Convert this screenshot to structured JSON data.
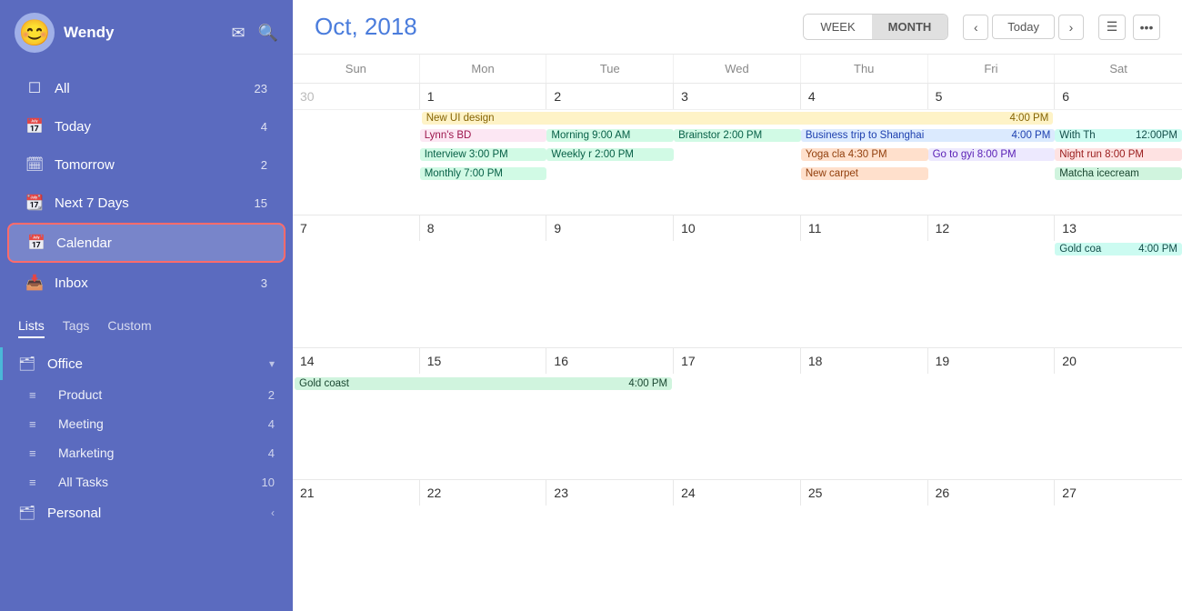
{
  "sidebar": {
    "user": {
      "name": "Wendy",
      "avatar_emoji": "😊"
    },
    "nav_items": [
      {
        "id": "all",
        "label": "All",
        "badge": "23",
        "icon": "☐"
      },
      {
        "id": "today",
        "label": "Today",
        "badge": "4",
        "icon": "📅"
      },
      {
        "id": "tomorrow",
        "label": "Tomorrow",
        "badge": "2",
        "icon": "🗓"
      },
      {
        "id": "next7",
        "label": "Next 7 Days",
        "badge": "15",
        "icon": "📆"
      },
      {
        "id": "calendar",
        "label": "Calendar",
        "badge": "",
        "icon": "📅",
        "active": true
      },
      {
        "id": "inbox",
        "label": "Inbox",
        "badge": "3",
        "icon": "📥"
      }
    ],
    "tabs": [
      {
        "id": "lists",
        "label": "Lists",
        "active": true
      },
      {
        "id": "tags",
        "label": "Tags"
      },
      {
        "id": "custom",
        "label": "Custom"
      }
    ],
    "sections": [
      {
        "id": "office",
        "label": "Office",
        "icon": "🗂",
        "has_bar": true
      },
      {
        "id": "product",
        "label": "Product",
        "icon": "≡",
        "badge": "2",
        "indent": true
      },
      {
        "id": "meeting",
        "label": "Meeting",
        "icon": "≡",
        "badge": "4",
        "indent": true
      },
      {
        "id": "marketing",
        "label": "Marketing",
        "icon": "≡",
        "badge": "4",
        "indent": true
      },
      {
        "id": "alltasks",
        "label": "All Tasks",
        "icon": "≡",
        "badge": "10",
        "indent": true
      },
      {
        "id": "personal",
        "label": "Personal",
        "icon": "🗂"
      }
    ]
  },
  "calendar": {
    "title": "Oct, 2018",
    "view_week": "WEEK",
    "view_month": "MONTH",
    "today_label": "Today",
    "day_headers": [
      "Sun",
      "Mon",
      "Tue",
      "Wed",
      "Thu",
      "Fri",
      "Sat"
    ],
    "weeks": [
      {
        "days": [
          {
            "num": "30",
            "other": true,
            "events": []
          },
          {
            "num": "1",
            "events": [
              {
                "label": "New UI design",
                "color": "ev-yellow",
                "span": true
              }
            ]
          },
          {
            "num": "2",
            "events": []
          },
          {
            "num": "3",
            "events": []
          },
          {
            "num": "4",
            "time": "4:00 PM",
            "events": []
          },
          {
            "num": "5",
            "events": []
          },
          {
            "num": "6",
            "events": []
          }
        ],
        "spanning": [
          {
            "label": "New UI design",
            "start": 1,
            "end": 6,
            "color": "ev-yellow",
            "time_right": "4:00 PM"
          },
          {
            "label": "With Th",
            "start": 6,
            "end": 7,
            "color": "ev-teal",
            "time": "12:00 PM"
          }
        ],
        "row_events": [
          {
            "col": 1,
            "label": "Lynn's BD",
            "color": "ev-pink"
          },
          {
            "col": 2,
            "label": "Morning 9.00 AM",
            "color": "ev-green"
          },
          {
            "col": 3,
            "label": "Brainstor 2:00 PM",
            "color": "ev-green"
          },
          {
            "col": 4,
            "label": "Business trip to Shanghai",
            "color": "ev-blue",
            "span": 2,
            "time": "4:00 PM"
          },
          {
            "col": 6,
            "label": "Go to gyi 8:00 PM",
            "color": "ev-purple"
          },
          {
            "col": 7,
            "label": "Night run 8:00 PM",
            "color": "ev-red"
          }
        ],
        "row2_events": [
          {
            "col": 2,
            "label": "Interview 3:00 PM",
            "color": "ev-green"
          },
          {
            "col": 3,
            "label": "Weekly r 2:00 PM",
            "color": "ev-green"
          },
          {
            "col": 5,
            "label": "Yoga cla 4:30 PM",
            "color": "ev-orange"
          },
          {
            "col": 7,
            "label": "Matcha icecream",
            "color": "ev-mint"
          }
        ],
        "row3_events": [
          {
            "col": 2,
            "label": "Monthly 7:00 PM",
            "color": "ev-green"
          },
          {
            "col": 5,
            "label": "New carpet",
            "color": "ev-orange"
          }
        ]
      },
      {
        "days": [
          {
            "num": "7"
          },
          {
            "num": "8"
          },
          {
            "num": "9"
          },
          {
            "num": "10"
          },
          {
            "num": "11"
          },
          {
            "num": "12"
          },
          {
            "num": "13"
          }
        ],
        "row_events": [
          {
            "col": 7,
            "label": "Gold coa 4:00 PM",
            "color": "ev-teal"
          }
        ]
      },
      {
        "days": [
          {
            "num": "14"
          },
          {
            "num": "15"
          },
          {
            "num": "16"
          },
          {
            "num": "17"
          },
          {
            "num": "18"
          },
          {
            "num": "19"
          },
          {
            "num": "20"
          }
        ],
        "spanning": [
          {
            "label": "Gold coast",
            "start": 0,
            "end": 3,
            "color": "ev-mint",
            "time_right": "4:00 PM"
          }
        ]
      },
      {
        "days": [
          {
            "num": "21"
          },
          {
            "num": "22"
          },
          {
            "num": "23"
          },
          {
            "num": "24"
          },
          {
            "num": "25"
          },
          {
            "num": "26"
          },
          {
            "num": "27"
          }
        ]
      }
    ]
  }
}
